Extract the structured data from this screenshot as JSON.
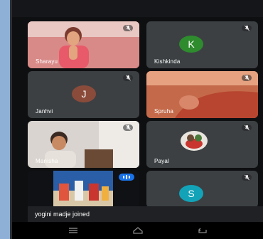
{
  "participants": [
    {
      "name": "Sharayu",
      "initial": "",
      "avatar_color": ""
    },
    {
      "name": "Kishkinda",
      "initial": "K",
      "avatar_color": "#2e8b2e"
    },
    {
      "name": "Janhvi",
      "initial": "J",
      "avatar_color": "#8a4b3b"
    },
    {
      "name": "Spruha",
      "initial": "",
      "avatar_color": ""
    },
    {
      "name": "Manisha",
      "initial": "",
      "avatar_color": ""
    },
    {
      "name": "Payal",
      "initial": "",
      "avatar_color": ""
    },
    {
      "name": "",
      "initial": "",
      "avatar_color": ""
    },
    {
      "name": "",
      "initial": "S",
      "avatar_color": "#12a3b8"
    }
  ],
  "toast": {
    "text": "yogini madje joined"
  },
  "icons": {
    "mute": "mic-off-icon",
    "speaking": "audio-level-icon",
    "nav_menu": "recents-icon",
    "nav_home": "home-icon",
    "nav_back": "back-icon"
  },
  "colors": {
    "tile_bg": "#3c4043",
    "accent": "#1a73e8"
  }
}
